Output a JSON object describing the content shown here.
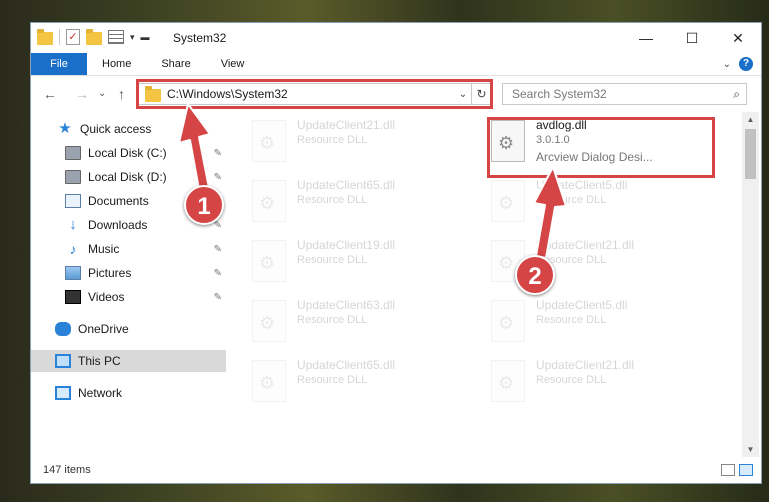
{
  "window": {
    "title": "System32",
    "controls": {
      "minimize": "—",
      "maximize": "☐",
      "close": "✕"
    }
  },
  "ribbon": {
    "tabs": [
      "File",
      "Home",
      "Share",
      "View"
    ],
    "help": "?",
    "collapse": "⌄"
  },
  "nav": {
    "back": "←",
    "forward": "→",
    "recent": "⌄",
    "up": "↑",
    "address": "C:\\Windows\\System32",
    "search_placeholder": "Search System32"
  },
  "sidebar": {
    "items": [
      {
        "label": "Quick access",
        "icon": "star-icon",
        "pinned": false
      },
      {
        "label": "Local Disk (C:)",
        "icon": "drive-icon",
        "pinned": true
      },
      {
        "label": "Local Disk (D:)",
        "icon": "drive-icon",
        "pinned": true
      },
      {
        "label": "Documents",
        "icon": "documents-icon",
        "pinned": true
      },
      {
        "label": "Downloads",
        "icon": "downloads-icon",
        "pinned": true
      },
      {
        "label": "Music",
        "icon": "music-icon",
        "pinned": true
      },
      {
        "label": "Pictures",
        "icon": "pictures-icon",
        "pinned": true
      },
      {
        "label": "Videos",
        "icon": "videos-icon",
        "pinned": true
      },
      {
        "label": "OneDrive",
        "icon": "onedrive-icon",
        "pinned": false
      },
      {
        "label": "This PC",
        "icon": "this-pc-icon",
        "pinned": false,
        "selected": true
      },
      {
        "label": "Network",
        "icon": "network-icon",
        "pinned": false
      }
    ]
  },
  "files": {
    "highlighted": {
      "name": "avdlog.dll",
      "version": "3.0.1.0",
      "description": "Arcview Dialog Desi..."
    },
    "background": [
      {
        "name": "UpdateClient21.dll",
        "type": "Resource DLL"
      },
      {
        "name": "UpdateClient65.dll",
        "type": "Resource DLL"
      },
      {
        "name": "UpdateClient5.dll",
        "type": "Resource DLL"
      },
      {
        "name": "UpdateClient19.dll",
        "type": "Resource DLL"
      },
      {
        "name": "UpdateClient21.dll",
        "type": "Resource DLL"
      },
      {
        "name": "UpdateClient63.dll",
        "type": "Resource DLL"
      },
      {
        "name": "UpdateClient5.dll",
        "type": "Resource DLL"
      },
      {
        "name": "UpdateClient65.dll",
        "type": "Resource DLL"
      },
      {
        "name": "UpdateClient21.dll",
        "type": "Resource DLL"
      }
    ]
  },
  "status": {
    "item_count": "147 items"
  },
  "callouts": {
    "one": "1",
    "two": "2"
  },
  "colors": {
    "accent": "#1a6fc9",
    "highlight": "#d64545"
  }
}
